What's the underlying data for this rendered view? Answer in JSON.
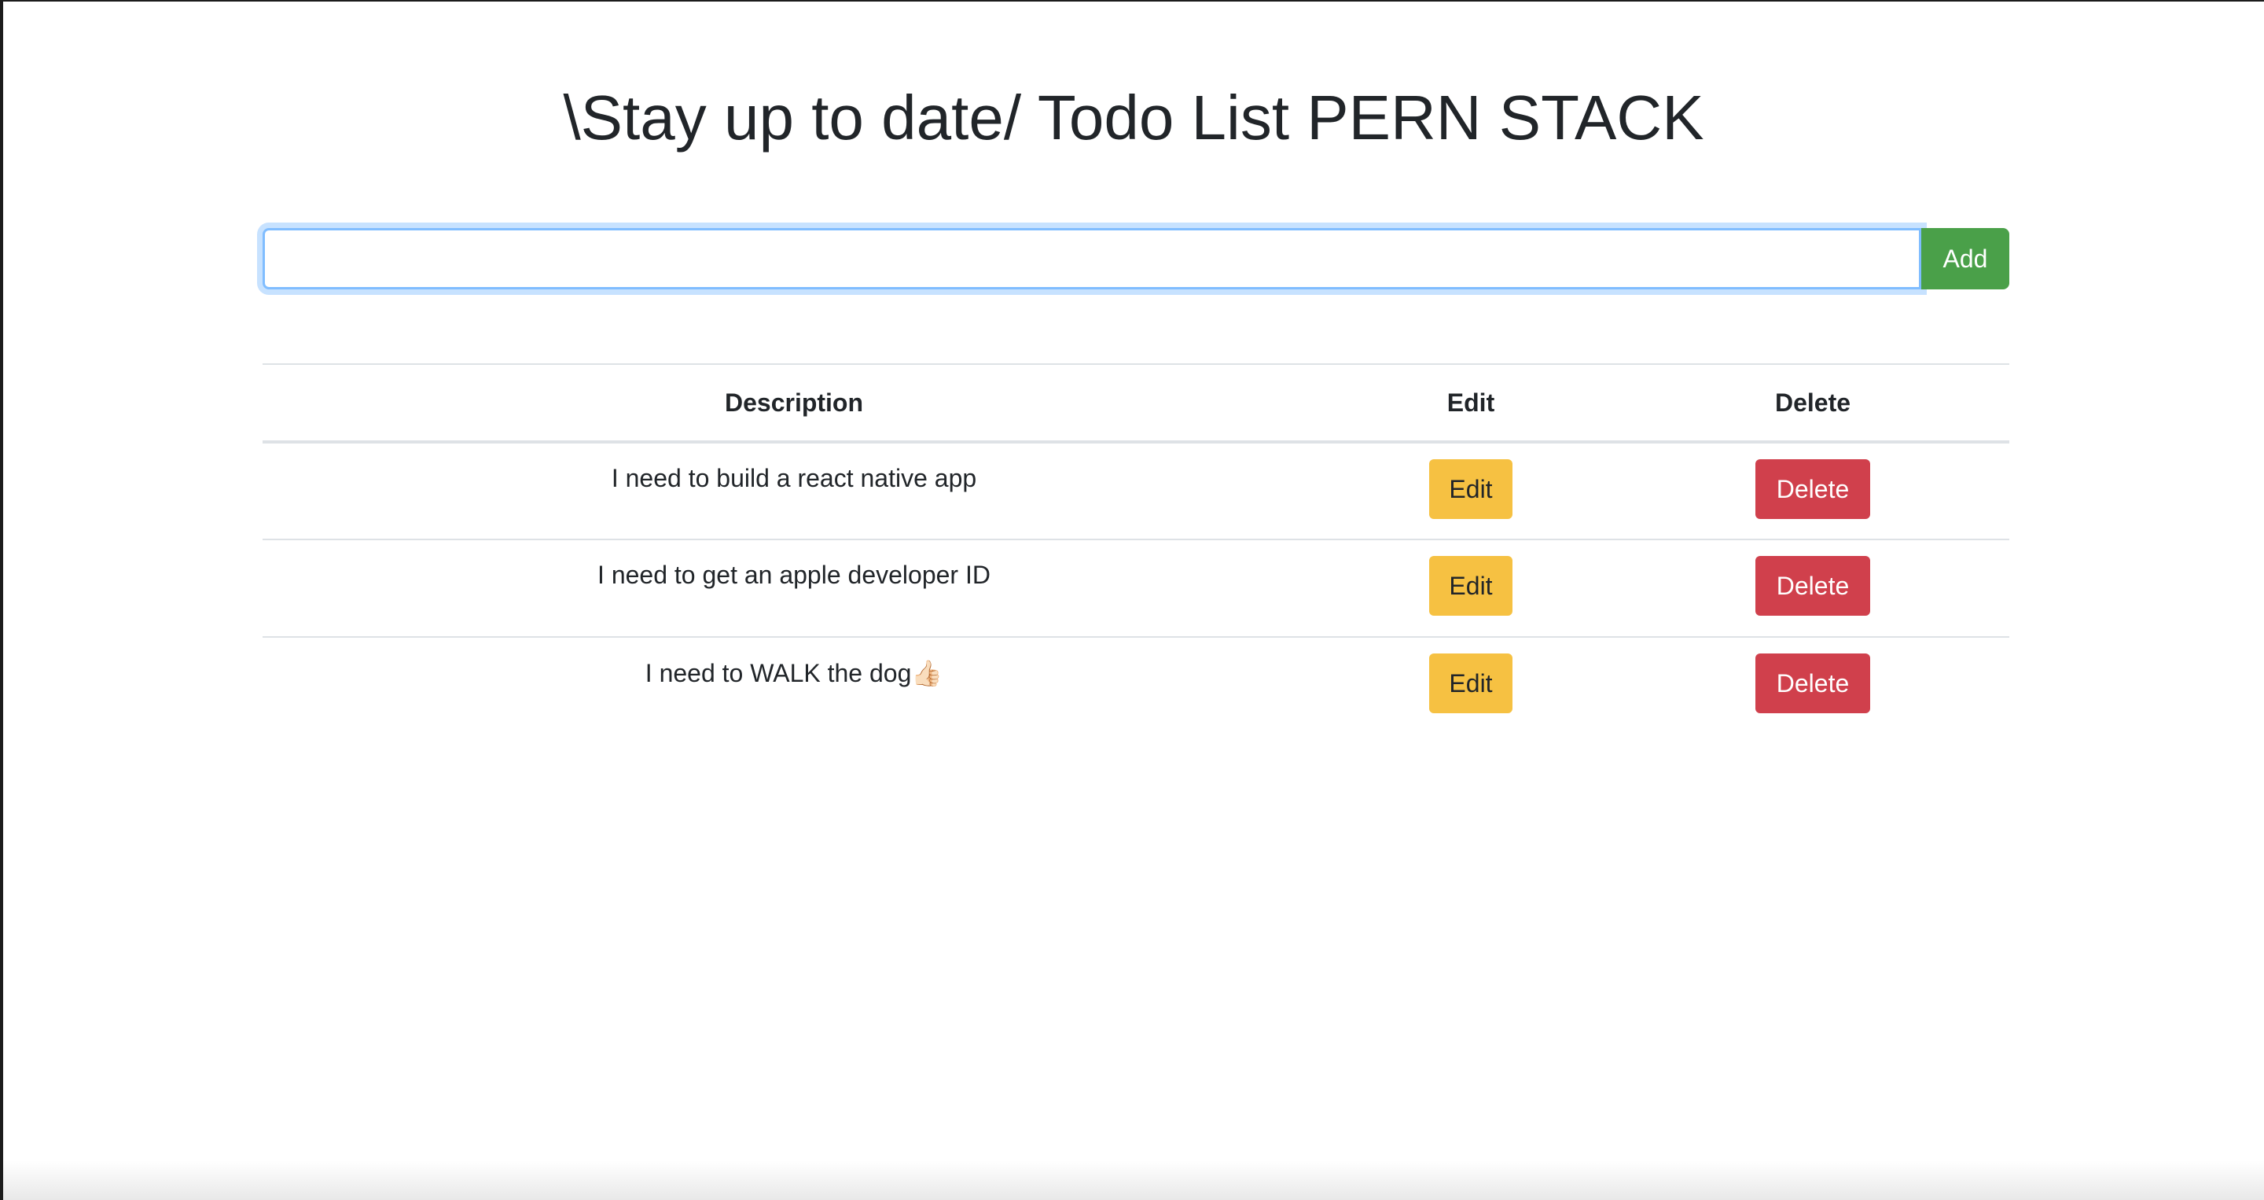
{
  "page": {
    "title": "\\Stay up to date/ Todo List PERN STACK"
  },
  "add_form": {
    "input_value": "",
    "add_label": "Add"
  },
  "table": {
    "headers": {
      "description": "Description",
      "edit": "Edit",
      "delete": "Delete"
    },
    "rows": [
      {
        "description": "I need to build a react native app",
        "edit_label": "Edit",
        "delete_label": "Delete"
      },
      {
        "description": "I need to get an apple developer ID",
        "edit_label": "Edit",
        "delete_label": "Delete"
      },
      {
        "description": "I need to WALK the dog👍🏻",
        "edit_label": "Edit",
        "delete_label": "Delete"
      }
    ]
  },
  "colors": {
    "add_button": "#4aa049",
    "edit_button": "#f6c142",
    "delete_button": "#d0404c",
    "input_focus_border": "#80bdff"
  }
}
